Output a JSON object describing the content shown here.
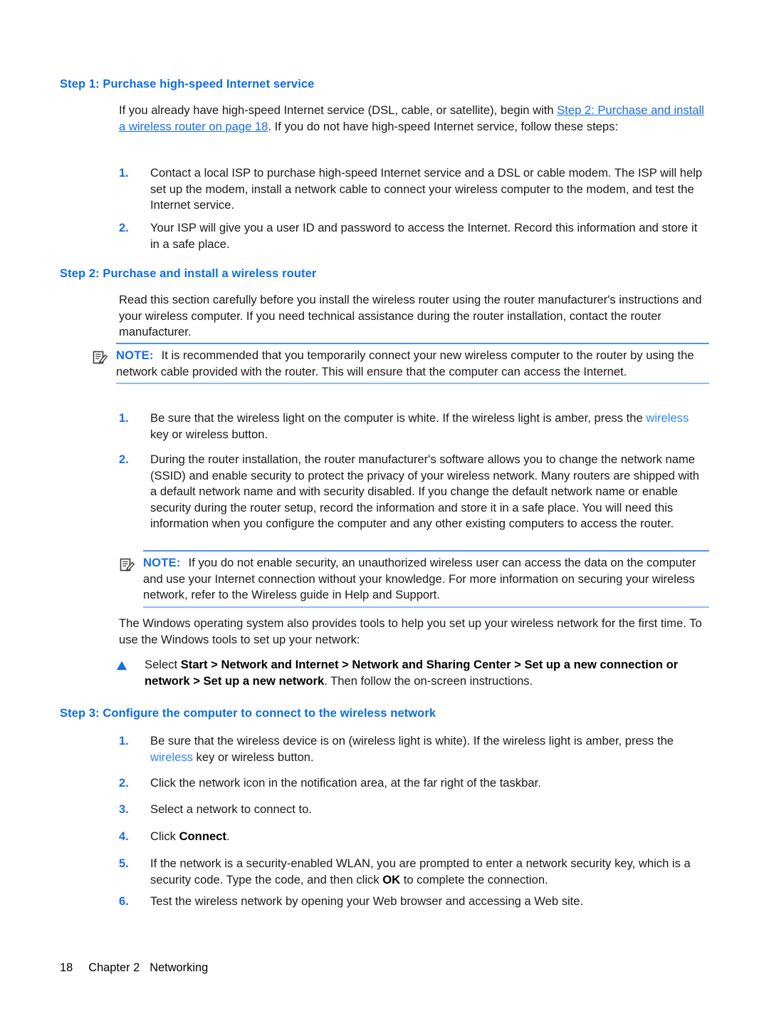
{
  "document": {
    "step1": {
      "heading": "Step 1: Purchase high-speed Internet service",
      "intro_a": "If you already have high-speed Internet service (DSL, cable, or satellite), begin with ",
      "intro_link": "Step 2: Purchase and install a wireless router on page 18",
      "intro_b": ". If you do not have high-speed Internet service, follow these steps:",
      "items": [
        {
          "num": "1.",
          "text": "Contact a local ISP to purchase high-speed Internet service and a DSL or cable modem. The ISP will help set up the modem, install a network cable to connect your wireless computer to the modem, and test the Internet service."
        },
        {
          "num": "2.",
          "text": "Your ISP will give you a user ID and password to access the Internet. Record this information and store it in a safe place."
        }
      ]
    },
    "step2": {
      "heading": "Step 2: Purchase and install a wireless router",
      "intro": "Read this section carefully before you install the wireless router using the router manufacturer's instructions and your wireless computer. If you need technical assistance during the router installation, contact the router manufacturer.",
      "note1": {
        "label": "NOTE:",
        "text": "It is recommended that you temporarily connect your new wireless computer to the router by using the network cable provided with the router. This will ensure that the computer can access the Internet."
      },
      "item1": {
        "num": "1.",
        "text_a": "Be sure that the wireless light on the computer is white. If the wireless light is amber, press the ",
        "keyword": "wireless",
        "text_b": " key or wireless button."
      },
      "item2": {
        "num": "2.",
        "text": "During the router installation, the router manufacturer's software allows you to change the network name (SSID) and enable security to protect the privacy of your wireless network. Many routers are shipped with a default network name and with security disabled. If you change the default network name or enable security during the router setup, record the information and store it in a safe place. You will need this information when you configure the computer and any other existing computers to access the router."
      },
      "note2": {
        "label": "NOTE:",
        "text": "If you do not enable security, an unauthorized wireless user can access the data on the computer and use your Internet connection without your knowledge. For more information on securing your wireless network, refer to the Wireless guide in Help and Support."
      },
      "windows_para": "The Windows operating system also provides tools to help you set up your wireless network for the first time. To use the Windows tools to set up your network:",
      "bullet": {
        "lead": "Select ",
        "path": "Start > Network and Internet > Network and Sharing Center > Set up a new connection or network > Set up a new network",
        "tail": ". Then follow the on-screen instructions."
      }
    },
    "step3": {
      "heading": "Step 3: Configure the computer to connect to the wireless network",
      "items": [
        {
          "num": "1.",
          "text_a": "Be sure that the wireless device is on (wireless light is white). If the wireless light is amber, press the ",
          "keyword": "wireless",
          "text_b": " key or wireless button."
        },
        {
          "num": "2.",
          "text": "Click the network icon in the notification area, at the far right of the taskbar."
        },
        {
          "num": "3.",
          "text": "Select a network to connect to."
        },
        {
          "num": "4.",
          "text_a": "Click ",
          "bold": "Connect",
          "text_b": "."
        },
        {
          "num": "5.",
          "text_a": "If the network is a security-enabled WLAN, you are prompted to enter a network security key, which is a security code. Type the code, and then click ",
          "bold": "OK",
          "text_b": " to complete the connection."
        },
        {
          "num": "6.",
          "text": "Test the wireless network by opening your Web browser and accessing a Web site."
        }
      ]
    },
    "footer": {
      "page_number": "18",
      "chapter": "Chapter 2",
      "chapter_title": "Networking"
    },
    "colors": {
      "heading_blue": "#0d6ee0",
      "link_blue": "#1a6ee0",
      "keyword_blue": "#2f86f0",
      "rule_blue": "#4a95ee",
      "rule_blue_light": "#8dbcf2",
      "body_black": "#1a1a1a"
    },
    "icons": {
      "note": "notepad-pencil-icon",
      "bullet": "triangle-up-icon"
    }
  }
}
